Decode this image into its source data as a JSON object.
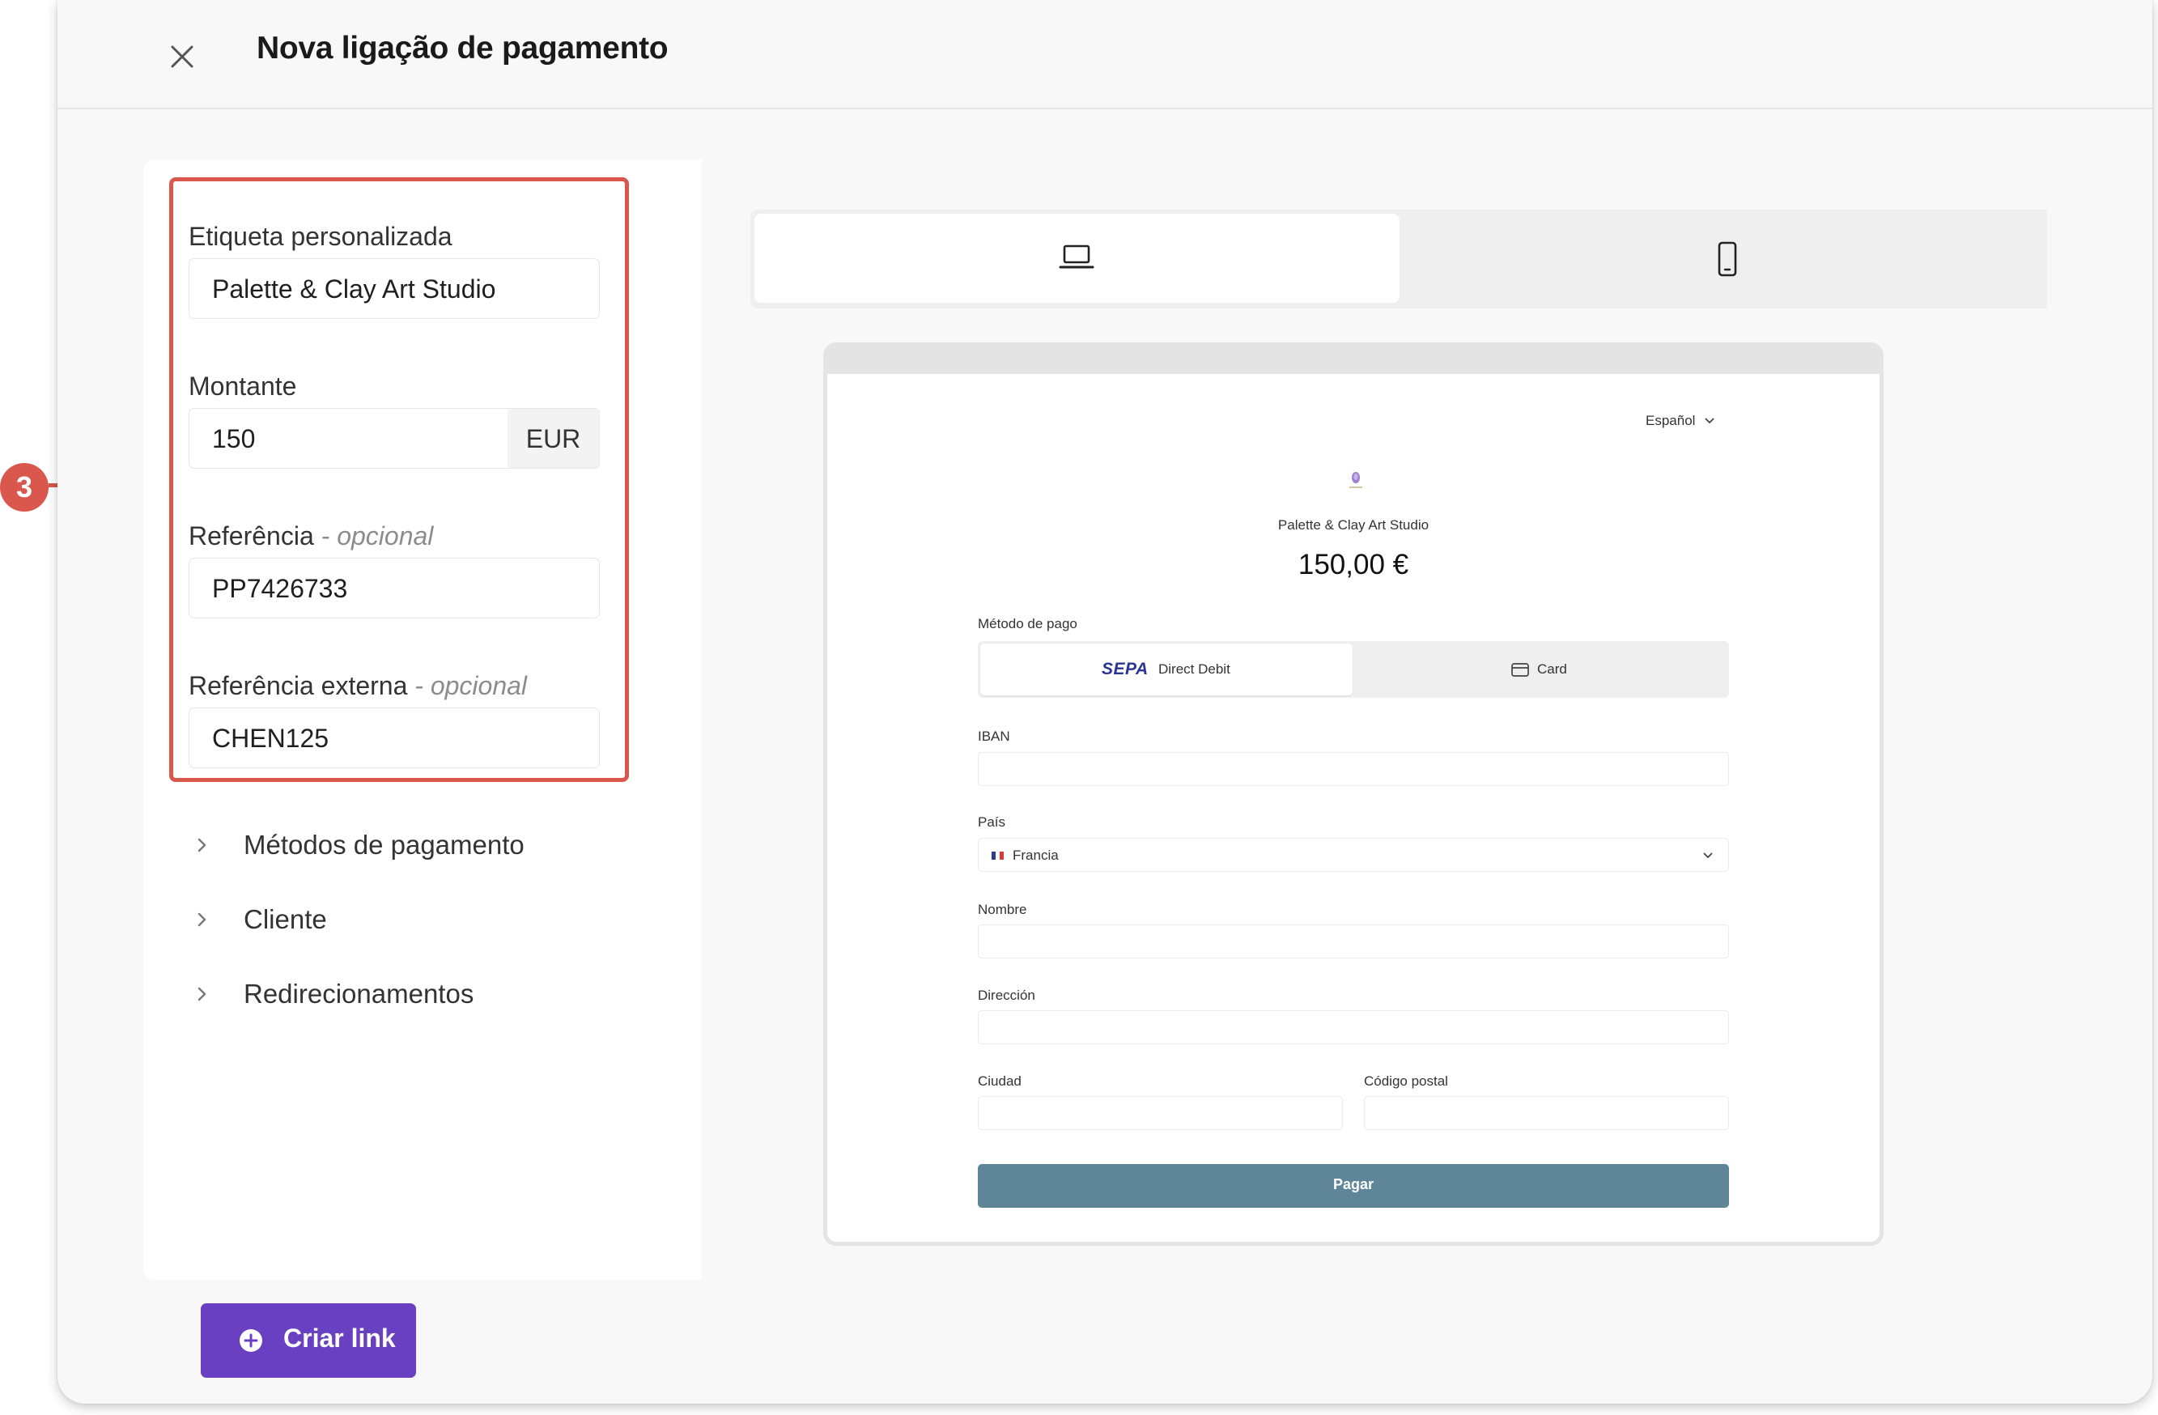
{
  "header": {
    "title": "Nova ligação de pagamento"
  },
  "form": {
    "custom_label": {
      "label": "Etiqueta personalizada",
      "value": "Palette & Clay Art Studio"
    },
    "amount": {
      "label": "Montante",
      "value": "150",
      "currency": "EUR"
    },
    "reference": {
      "label": "Referência",
      "optional": "- opcional",
      "value": "PP7426733"
    },
    "external_reference": {
      "label": "Referência externa",
      "optional": "- opcional",
      "value": "CHEN125"
    }
  },
  "sections": [
    "Métodos de pagamento",
    "Cliente",
    "Redirecionamentos"
  ],
  "device_toggle": {
    "active": "desktop",
    "options": [
      "desktop-icon",
      "mobile-icon"
    ]
  },
  "preview": {
    "language": "Español",
    "merchant": "Palette & Clay Art Studio",
    "amount": "150,00 €",
    "payment_method_label": "Método de pago",
    "methods": {
      "sepa_brand": "SEPA",
      "sepa": "Direct Debit",
      "card": "Card"
    },
    "fields": {
      "iban": "IBAN",
      "country": "País",
      "country_value": "Francia",
      "name": "Nombre",
      "address": "Dirección",
      "city": "Ciudad",
      "postal": "Código postal"
    },
    "pay_button": "Pagar"
  },
  "cta": {
    "label": "Criar link"
  },
  "annotation": {
    "step": "3"
  },
  "colors": {
    "accent": "#6a40c3",
    "highlight": "#d9574c",
    "pay_button": "#5f8698"
  }
}
